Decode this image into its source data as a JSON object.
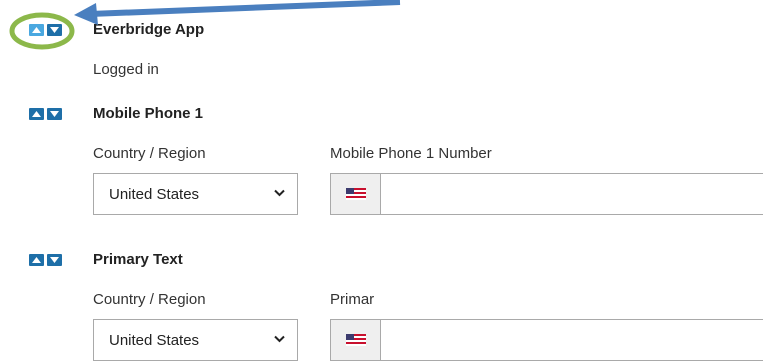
{
  "icons": {
    "move_up": "caret-up-icon",
    "move_down": "caret-down-icon",
    "dropdown": "chevron-down-icon",
    "flag": "us-flag-icon",
    "arrow": "arrow-callout",
    "circle": "circle-highlight"
  },
  "colors": {
    "button_blue": "#1e6fa8",
    "button_highlight": "#4aa8e0",
    "callout_arrow": "#4a7fbf",
    "callout_circle": "#8cb84a",
    "border": "#a9a9a9"
  },
  "sections": [
    {
      "title": "Everbridge App",
      "status": "Logged in"
    },
    {
      "title": "Mobile Phone 1",
      "country_label": "Country / Region",
      "country_value": "United States",
      "number_label": "Mobile Phone 1 Number",
      "number_value": ""
    },
    {
      "title": "Primary Text",
      "country_label": "Country / Region",
      "country_value": "United States",
      "number_label": "Primar",
      "number_value": ""
    }
  ]
}
